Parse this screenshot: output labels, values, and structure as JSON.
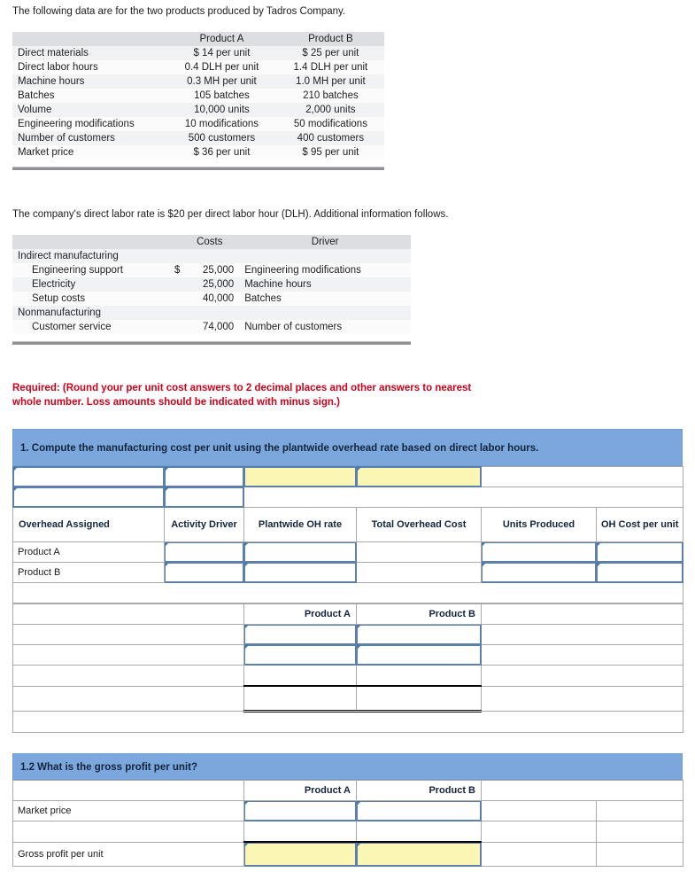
{
  "intro": {
    "line1": "The following data are for the two products produced by Tadros Company.",
    "line2": "The company's direct labor rate is $20 per direct labor hour (DLH). Additional information follows."
  },
  "product_table": {
    "headers": [
      "",
      "Product A",
      "Product B"
    ],
    "rows": [
      {
        "label": "Direct materials",
        "a": "$ 14 per unit",
        "b": "$ 25 per unit"
      },
      {
        "label": "Direct labor hours",
        "a": "0.4 DLH per unit",
        "b": "1.4 DLH per unit"
      },
      {
        "label": "Machine hours",
        "a": "0.3 MH per unit",
        "b": "1.0 MH per unit"
      },
      {
        "label": "Batches",
        "a": "105 batches",
        "b": "210 batches"
      },
      {
        "label": "Volume",
        "a": "10,000 units",
        "b": "2,000 units"
      },
      {
        "label": "Engineering modifications",
        "a": "10 modifications",
        "b": "50 modifications"
      },
      {
        "label": "Number of customers",
        "a": "500 customers",
        "b": "400 customers"
      },
      {
        "label": "Market price",
        "a": "$ 36 per unit",
        "b": "$ 95 per unit"
      }
    ]
  },
  "cost_table": {
    "headers": [
      "",
      "Costs",
      "Driver"
    ],
    "rows": [
      {
        "label": "Indirect manufacturing",
        "indent": 0,
        "currency": "",
        "cost": "",
        "driver": ""
      },
      {
        "label": "Engineering support",
        "indent": 1,
        "currency": "$",
        "cost": "25,000",
        "driver": "Engineering modifications"
      },
      {
        "label": "Electricity",
        "indent": 1,
        "currency": "",
        "cost": "25,000",
        "driver": "Machine hours"
      },
      {
        "label": "Setup costs",
        "indent": 1,
        "currency": "",
        "cost": "40,000",
        "driver": "Batches"
      },
      {
        "label": "Nonmanufacturing",
        "indent": 0,
        "currency": "",
        "cost": "",
        "driver": ""
      },
      {
        "label": "Customer service",
        "indent": 1,
        "currency": "",
        "cost": "74,000",
        "driver": "Number of customers"
      }
    ]
  },
  "required": {
    "lead": "Required:",
    "text1": " (Round your per unit cost answers to 2 decimal places and other answers to nearest",
    "text2": "whole number. Loss amounts should be indicated with minus sign.)"
  },
  "question1": {
    "band": "1.  Compute the manufacturing cost per unit using the plantwide overhead rate based on direct labor hours.",
    "overhead_headers": [
      "Overhead Assigned",
      "Activity Driver",
      "Plantwide OH rate",
      "Total Overhead Cost",
      "Units Produced",
      "OH Cost per unit"
    ],
    "overhead_rows": [
      "Product A",
      "Product B"
    ],
    "product_headers": [
      "",
      "Product A",
      "Product B"
    ]
  },
  "question2": {
    "band": "1.2  What is the gross profit per unit?",
    "product_headers": [
      "",
      "Product A",
      "Product B"
    ],
    "rows": [
      "Market price",
      "",
      "Gross profit per unit"
    ]
  },
  "colors": {
    "band_blue": "#7BA7DC",
    "header_blue_grey": "#B0BFD9",
    "input_yellow": "#FBF6B4",
    "input_border": "#5B80AD",
    "required_red": "#D0021B",
    "table_header_grey": "#DCDEE1"
  }
}
